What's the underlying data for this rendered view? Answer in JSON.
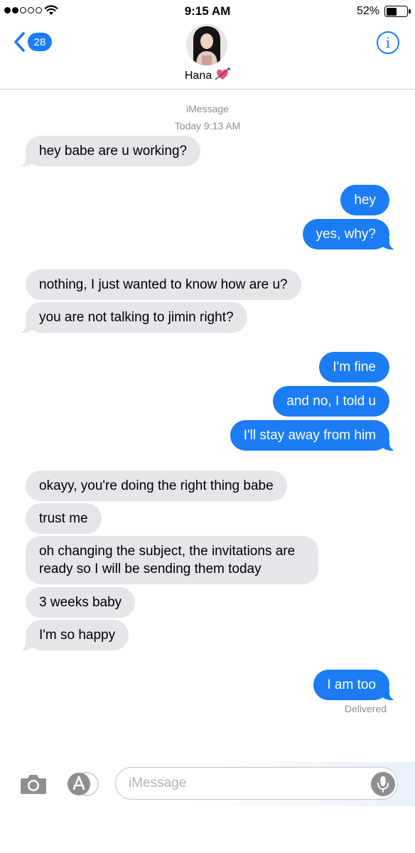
{
  "status_bar": {
    "time": "9:15 AM",
    "battery_percent": "52%",
    "battery_level": 0.52,
    "signal_bars": 2,
    "signal_total": 5
  },
  "header": {
    "unread_count": "28",
    "contact_name": "Hana",
    "contact_emoji": "heart-with-arrow-icon",
    "info_label": "i"
  },
  "thread": {
    "service": "iMessage",
    "timestamp": "Today 9:13 AM",
    "messages": [
      {
        "from": "them",
        "text": "hey babe are u working?"
      },
      {
        "from": "me",
        "text": "hey"
      },
      {
        "from": "me",
        "text": "yes, why?"
      },
      {
        "from": "them",
        "text": "nothing, I just wanted to know how are u?"
      },
      {
        "from": "them",
        "text": "you are not talking to jimin right?"
      },
      {
        "from": "me",
        "text": "I'm fine"
      },
      {
        "from": "me",
        "text": "and no, I told u"
      },
      {
        "from": "me",
        "text": "I'll stay away from him"
      },
      {
        "from": "them",
        "text": "okayy, you're doing the right thing babe"
      },
      {
        "from": "them",
        "text": "trust me"
      },
      {
        "from": "them",
        "text": "oh changing the subject, the invitations are ready so I will be sending them today"
      },
      {
        "from": "them",
        "text": "3 weeks baby"
      },
      {
        "from": "them",
        "text": "I'm so happy"
      },
      {
        "from": "me",
        "text": "I am too"
      }
    ],
    "delivery_status": "Delivered"
  },
  "input_bar": {
    "placeholder": "iMessage",
    "value": "",
    "icons": [
      "camera-icon",
      "app-store-icon",
      "microphone-icon"
    ]
  },
  "colors": {
    "accent": "#1b7cf3",
    "incoming_bubble": "#e5e5ea",
    "meta_text": "#8e8e93"
  }
}
